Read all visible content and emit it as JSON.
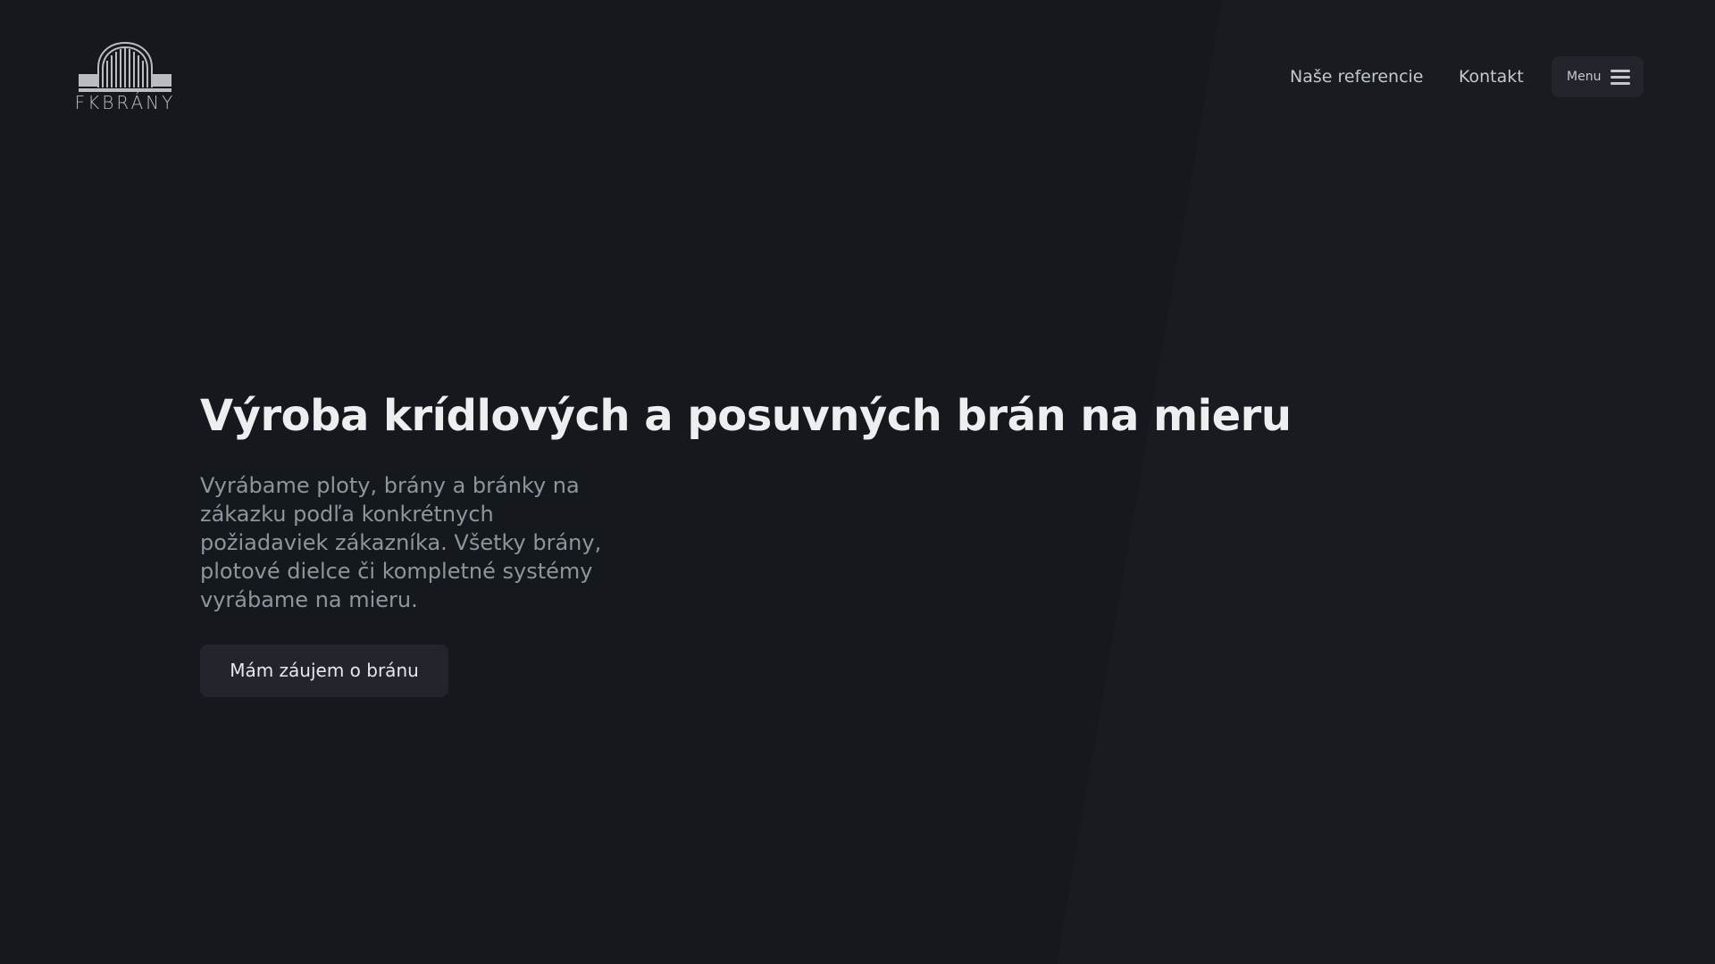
{
  "header": {
    "logo_text": "FKBRÁNY",
    "nav": {
      "references_label": "Naše referencie",
      "contact_label": "Kontakt",
      "menu_label": "Menu"
    }
  },
  "hero": {
    "title": "Výroba krídlových a posuvných brán na mieru",
    "description": "Vyrábame ploty, brány a bránky na zákazku podľa konkrétnych požiadaviek zákazníka. Všetky brány, plotové dielce či kompletné systémy vyrábame na mieru.",
    "cta_label": "Mám záujem o bránu"
  },
  "icons": {
    "logo": "gate-arch-logo-icon",
    "menu": "hamburger-menu-icon"
  },
  "colors": {
    "background": "#15191e",
    "panel": "#181c20",
    "button_background": "#22262c",
    "heading": "#eceef0",
    "body_text": "#8f959c",
    "nav_text": "#c4c8cd"
  }
}
